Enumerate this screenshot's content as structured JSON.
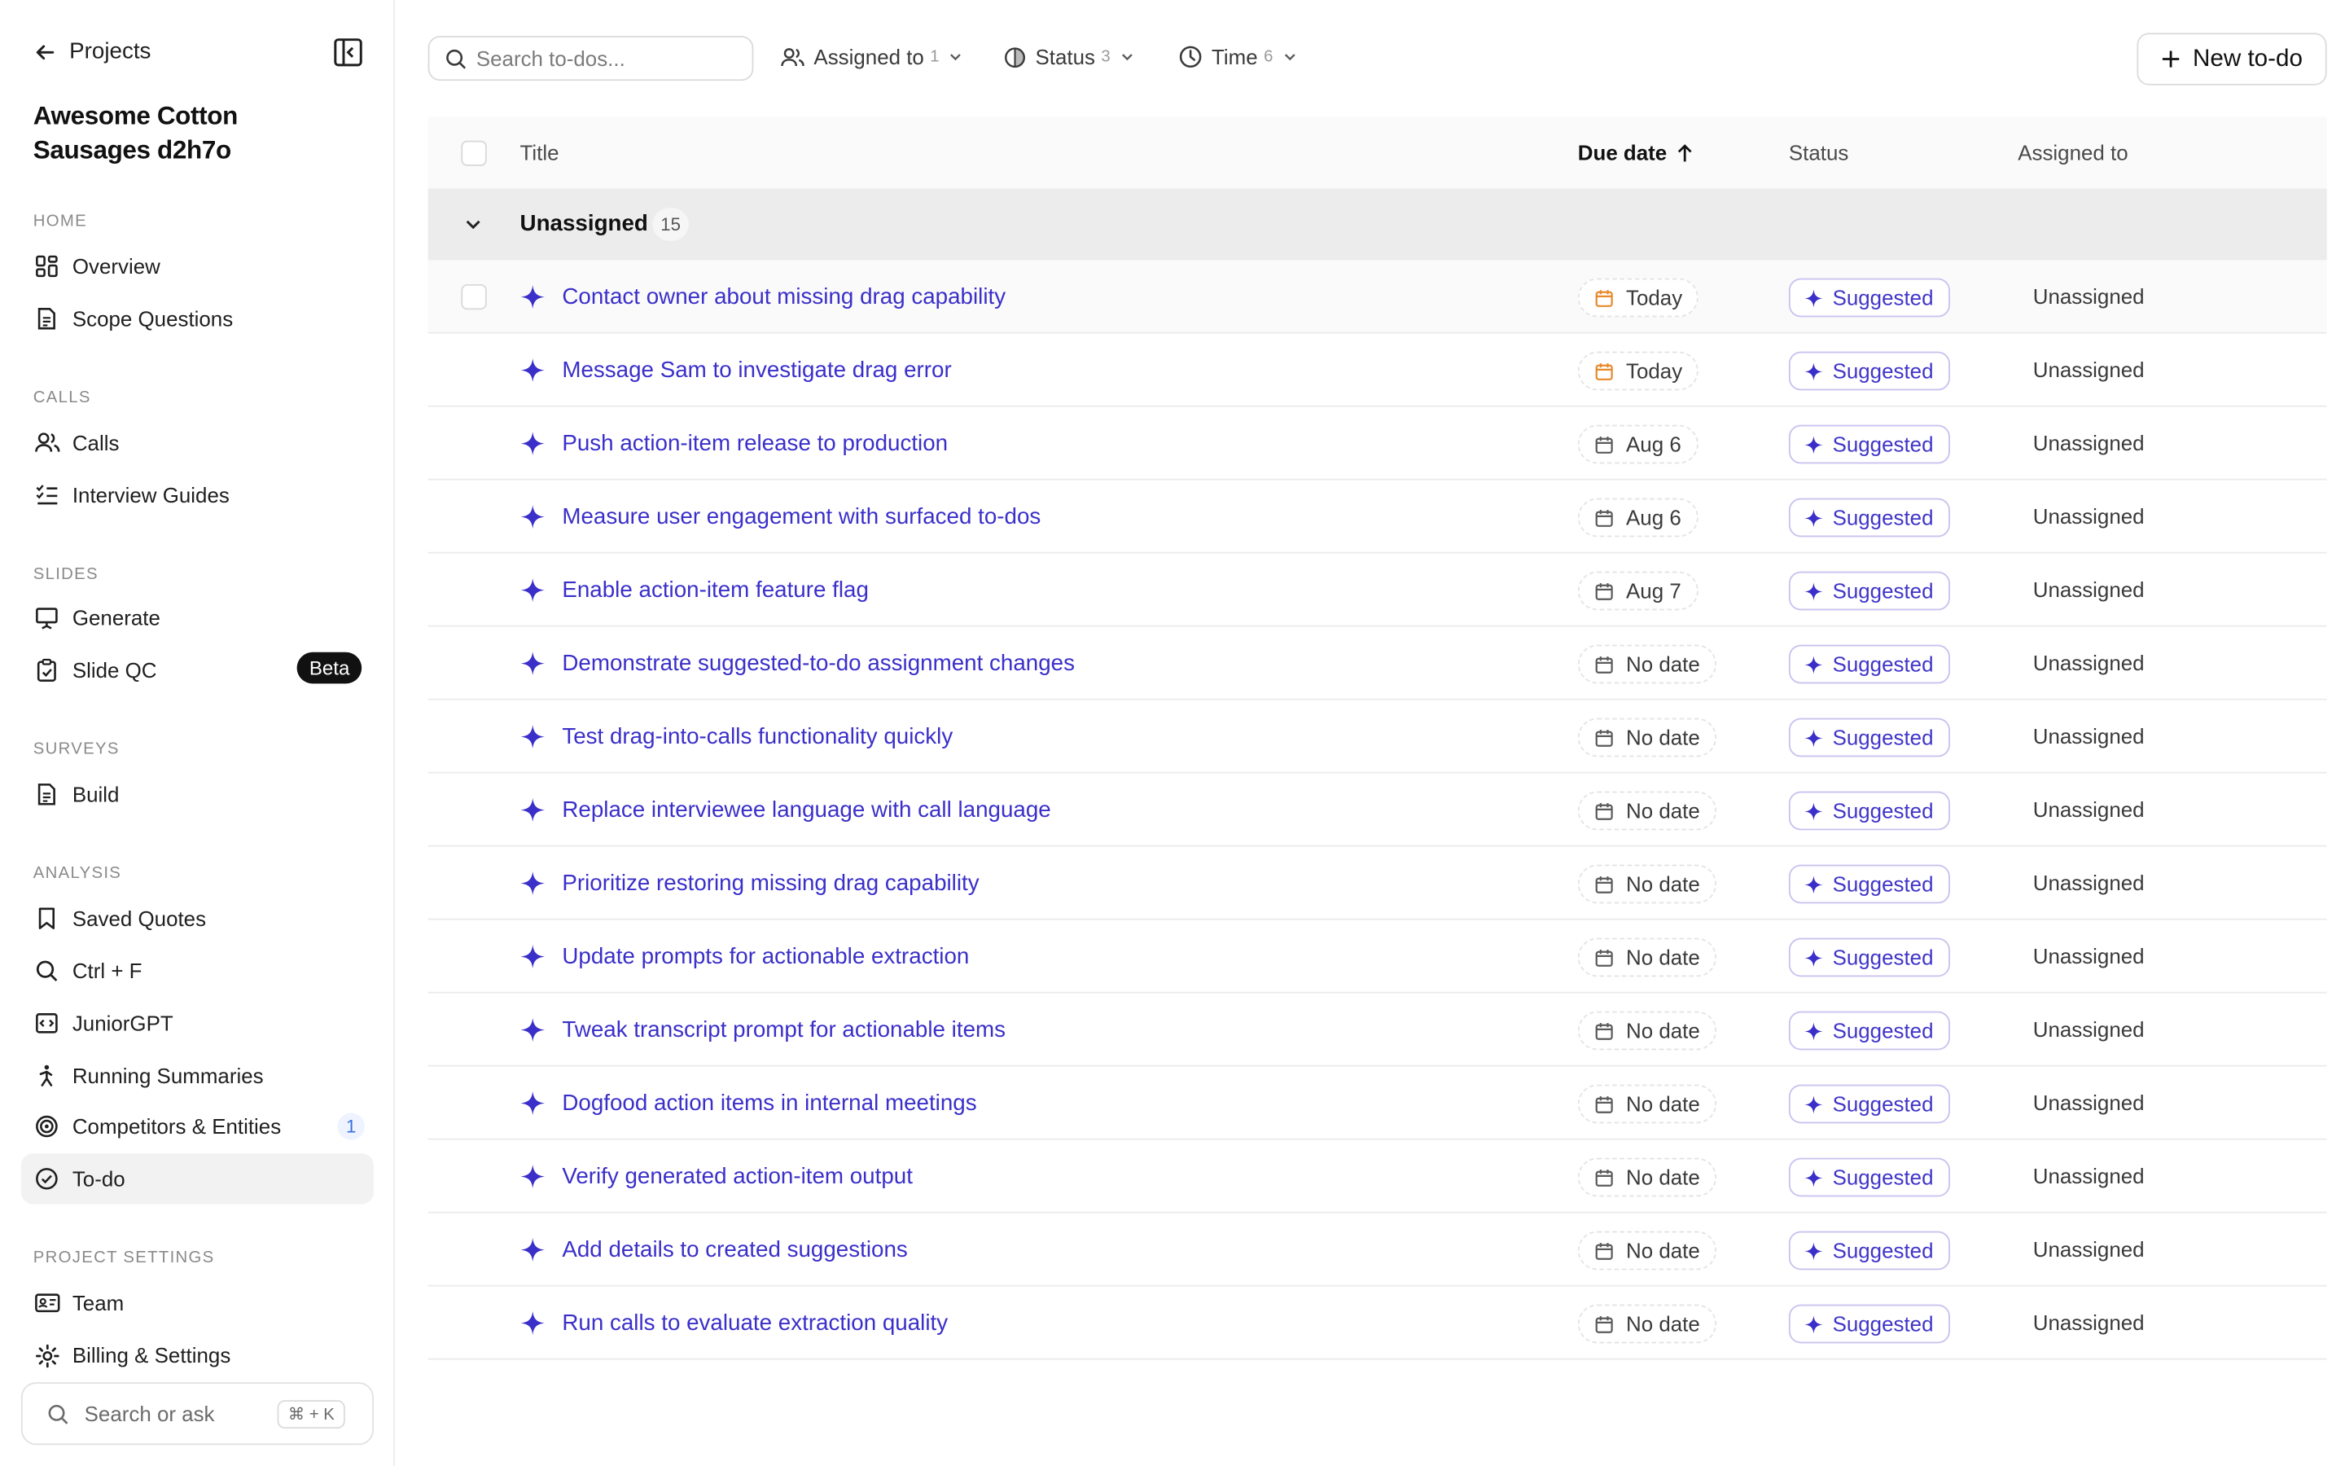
{
  "sidebar": {
    "back_label": "Projects",
    "project_title": "Awesome Cotton Sausages d2h7o",
    "sections": {
      "home": "HOME",
      "calls": "CALLS",
      "slides": "SLIDES",
      "surveys": "SURVEYS",
      "analysis": "ANALYSIS",
      "project_settings": "PROJECT SETTINGS"
    },
    "items": {
      "overview": "Overview",
      "scope_questions": "Scope Questions",
      "calls": "Calls",
      "interview_guides": "Interview Guides",
      "generate": "Generate",
      "slide_qc": "Slide QC",
      "slide_qc_badge": "Beta",
      "build": "Build",
      "saved_quotes": "Saved Quotes",
      "ctrl_f": "Ctrl + F",
      "juniorgpt": "JuniorGPT",
      "running_summaries": "Running Summaries",
      "competitors": "Competitors & Entities",
      "competitors_count": "1",
      "todo": "To-do",
      "team": "Team",
      "billing": "Billing & Settings"
    },
    "search_label": "Search or ask",
    "search_shortcut": "⌘ + K"
  },
  "toolbar": {
    "search_placeholder": "Search to-dos...",
    "filters": {
      "assigned_label": "Assigned to",
      "assigned_count": "1",
      "status_label": "Status",
      "status_count": "3",
      "time_label": "Time",
      "time_count": "6"
    },
    "new_button": "New to-do"
  },
  "table": {
    "headers": {
      "title": "Title",
      "due_date": "Due date",
      "status": "Status",
      "assigned_to": "Assigned to"
    },
    "group": {
      "name": "Unassigned",
      "count": "15"
    },
    "rows": [
      {
        "title": "Contact owner about missing drag capability",
        "due": "Today",
        "status": "Suggested",
        "assignee": "Unassigned"
      },
      {
        "title": "Message Sam to investigate drag error",
        "due": "Today",
        "status": "Suggested",
        "assignee": "Unassigned"
      },
      {
        "title": "Push action-item release to production",
        "due": "Aug 6",
        "status": "Suggested",
        "assignee": "Unassigned"
      },
      {
        "title": "Measure user engagement with surfaced to-dos",
        "due": "Aug 6",
        "status": "Suggested",
        "assignee": "Unassigned"
      },
      {
        "title": "Enable action-item feature flag",
        "due": "Aug 7",
        "status": "Suggested",
        "assignee": "Unassigned"
      },
      {
        "title": "Demonstrate suggested-to-do assignment changes",
        "due": "No date",
        "status": "Suggested",
        "assignee": "Unassigned"
      },
      {
        "title": "Test drag-into-calls functionality quickly",
        "due": "No date",
        "status": "Suggested",
        "assignee": "Unassigned"
      },
      {
        "title": "Replace interviewee language with call language",
        "due": "No date",
        "status": "Suggested",
        "assignee": "Unassigned"
      },
      {
        "title": "Prioritize restoring missing drag capability",
        "due": "No date",
        "status": "Suggested",
        "assignee": "Unassigned"
      },
      {
        "title": "Update prompts for actionable extraction",
        "due": "No date",
        "status": "Suggested",
        "assignee": "Unassigned"
      },
      {
        "title": "Tweak transcript prompt for actionable items",
        "due": "No date",
        "status": "Suggested",
        "assignee": "Unassigned"
      },
      {
        "title": "Dogfood action items in internal meetings",
        "due": "No date",
        "status": "Suggested",
        "assignee": "Unassigned"
      },
      {
        "title": "Verify generated action-item output",
        "due": "No date",
        "status": "Suggested",
        "assignee": "Unassigned"
      },
      {
        "title": "Add details to created suggestions",
        "due": "No date",
        "status": "Suggested",
        "assignee": "Unassigned"
      },
      {
        "title": "Run calls to evaluate extraction quality",
        "due": "No date",
        "status": "Suggested",
        "assignee": "Unassigned"
      }
    ]
  },
  "colors": {
    "accent": "#3a2fc9",
    "today": "#e8892b",
    "status_border": "#c9c3ef",
    "group_bg": "#ececec"
  },
  "icons": {
    "suggestion": "sparkle-icon",
    "date": "calendar-icon",
    "sort": "arrow-up-icon"
  }
}
